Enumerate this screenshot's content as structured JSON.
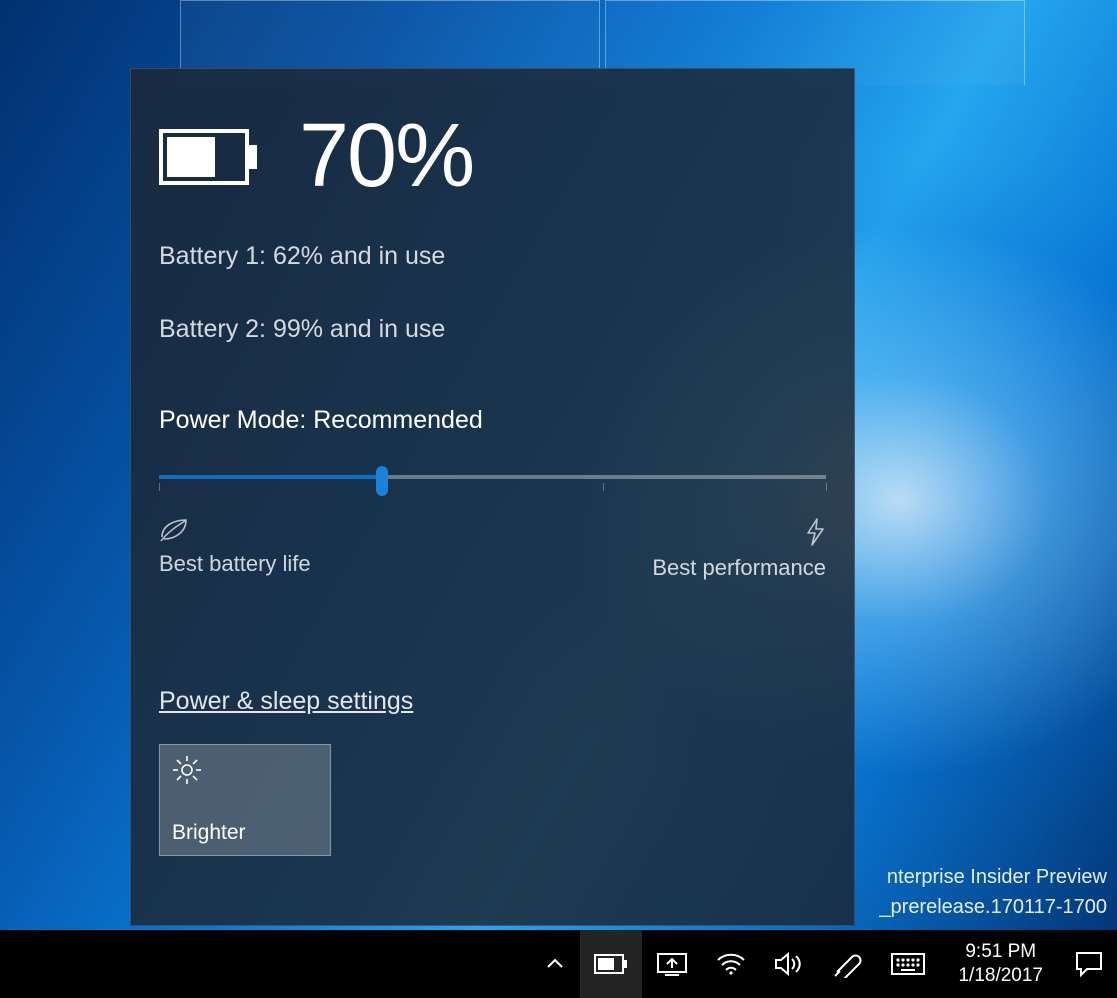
{
  "flyout": {
    "percent": "70%",
    "battery1": "Battery 1: 62% and in use",
    "battery2": "Battery 2: 99% and in use",
    "mode_label": "Power Mode: Recommended",
    "slider_left_label": "Best battery life",
    "slider_right_label": "Best performance",
    "settings_link": "Power & sleep settings",
    "tile_label": "Brighter",
    "slider_position_pct": 33.5
  },
  "watermark": {
    "line1": "nterprise Insider Preview",
    "line2": "_prerelease.170117-1700"
  },
  "taskbar": {
    "time": "9:51 PM",
    "date": "1/18/2017"
  }
}
